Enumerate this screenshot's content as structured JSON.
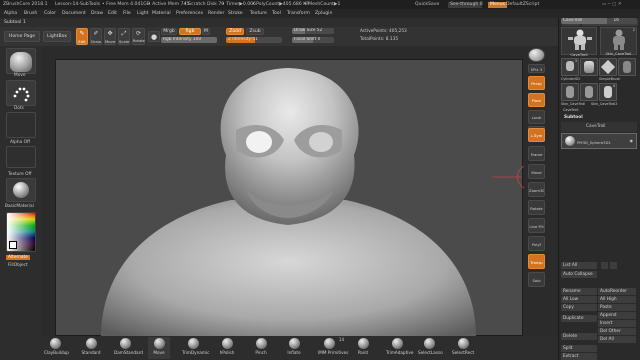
{
  "titlebar": {
    "app": "ZBrushCore 2018.1",
    "file": "Lesson-14-SubTools",
    "free_mem": "• Free Mem 4.041GB",
    "active_mem": "• Active Mem 745",
    "scratch": "• Scratch Disk 70",
    "timer": "• Timer▶0.006",
    "polycount": "• PolyCount▶405.686 KP",
    "meshcount": "• MeshCount▶1",
    "quicksave": "QuickSave",
    "seethrough": "See-through 0",
    "menus_btn": "Menus",
    "defaultscript": "DefaultZScript"
  },
  "menubar": [
    "Alpha",
    "Brush",
    "Color",
    "Document",
    "Draw",
    "Edit",
    "File",
    "Light",
    "Material",
    "Preferences",
    "Render",
    "Stroke",
    "Texture",
    "Tool",
    "Transform",
    "Zplugin"
  ],
  "subtool_label": "Subtool 1",
  "toolbar": {
    "home": "Home Page",
    "lightbox": "LightBox",
    "edit": "Edit",
    "draw": "Draw",
    "move": "Move",
    "scale": "Scale",
    "rotate": "Rotate",
    "mrgb": "Mrgb",
    "rgb": "Rgb",
    "m": "M",
    "zadd": "Zadd",
    "zsub": "Zsub",
    "rgb_intensity": "Rgb Intensity 100",
    "z_intensity": "Z Intensity 51",
    "draw_size": "Draw Size 52",
    "focal_shift": "Focal Shift 0",
    "active_points": "ActivePoints: 405,253",
    "total_points": "TotalPoints: 8.135"
  },
  "leftpanel": {
    "brush": "Move",
    "stroke": "Dots",
    "alpha": "Alpha Off",
    "texture": "Texture Off",
    "material": "BasicMaterial",
    "gradient": "Alternate",
    "fill": "FillObject"
  },
  "rightstrip": [
    "BPR",
    "SPix 3",
    "Persp",
    "Floor",
    "Local",
    "Qxyz",
    "L.Sym",
    "Frame",
    "Move",
    "Zoom3D",
    "Rotate",
    "Line Fill",
    "Polyf",
    "Transp",
    "Solo"
  ],
  "rightpanel": {
    "clone": "Clone",
    "make_polymesh": "Make PolyMesh3D",
    "cavetroll_slider": "CaveTroll",
    "cavetroll_value": "16",
    "tools": [
      {
        "name": "CaveTroll",
        "count": ""
      },
      {
        "name": "Skin_CaveTroll",
        "count": "2"
      },
      {
        "name": "CaveTroll",
        "count": "3"
      },
      {
        "name": "CylinderSD",
        "count": ""
      },
      {
        "name": "SimpleBrush",
        "count": ""
      },
      {
        "name": "Skin_CaveTroll",
        "count": ""
      },
      {
        "name": "Skin_CaveTroll2",
        "count": ""
      },
      {
        "name": "CaveTroll",
        "count": "4"
      }
    ],
    "subtool_header": "Subtool",
    "subtools": [
      "CaveTroll",
      "PM3D_Sphere3D1"
    ],
    "list_all": "List All",
    "auto_collapse": "Auto Collapse",
    "rename": "Rename",
    "autoreorder": "AutoReorder",
    "all_low": "All Low",
    "all_high": "All High",
    "copy": "Copy",
    "paste": "Paste",
    "duplicate": "Duplicate",
    "append": "Append",
    "insert": "Insert",
    "delete": "Delete",
    "del_other": "Del Other",
    "del_all": "Del All",
    "split": "Split",
    "extract": "Extract"
  },
  "bottombar": [
    "ClayBuildup",
    "Standard",
    "DamStandard",
    "Move",
    "TrimDynamic",
    "hPolish",
    "Pinch",
    "Inflate",
    "IMM Primitives",
    "Paint",
    "TrimAdaptive",
    "SelectLasso",
    "SelectRect"
  ],
  "imm_count": "14",
  "colors": {
    "accent": "#d2731f",
    "viewport": "#4b4b4b",
    "panel": "#2a2a2a"
  }
}
